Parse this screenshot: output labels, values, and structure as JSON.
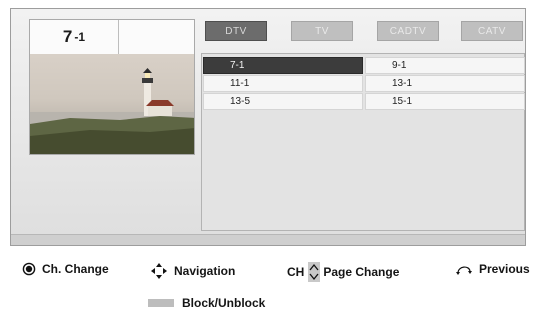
{
  "channel_info": {
    "major": "7",
    "minor": "-1"
  },
  "tabs": [
    {
      "label": "DTV",
      "active": true
    },
    {
      "label": "TV",
      "active": false
    },
    {
      "label": "CADTV",
      "active": false
    },
    {
      "label": "CATV",
      "active": false
    }
  ],
  "channels": [
    {
      "label": "7-1",
      "selected": true
    },
    {
      "label": "9-1",
      "selected": false
    },
    {
      "label": "11-1",
      "selected": false
    },
    {
      "label": "13-1",
      "selected": false
    },
    {
      "label": "13-5",
      "selected": false
    },
    {
      "label": "15-1",
      "selected": false
    }
  ],
  "legend": {
    "ch_change": "Ch. Change",
    "navigation": "Navigation",
    "ch_prefix": "CH",
    "page_change": "Page Change",
    "previous": "Previous",
    "block_unblock": "Block/Unblock"
  },
  "icons": {
    "ok": "ok-button-icon",
    "nav": "navigation-arrows-icon",
    "page": "page-up-down-icon",
    "back": "back-return-icon",
    "block": "gray-button-icon"
  }
}
